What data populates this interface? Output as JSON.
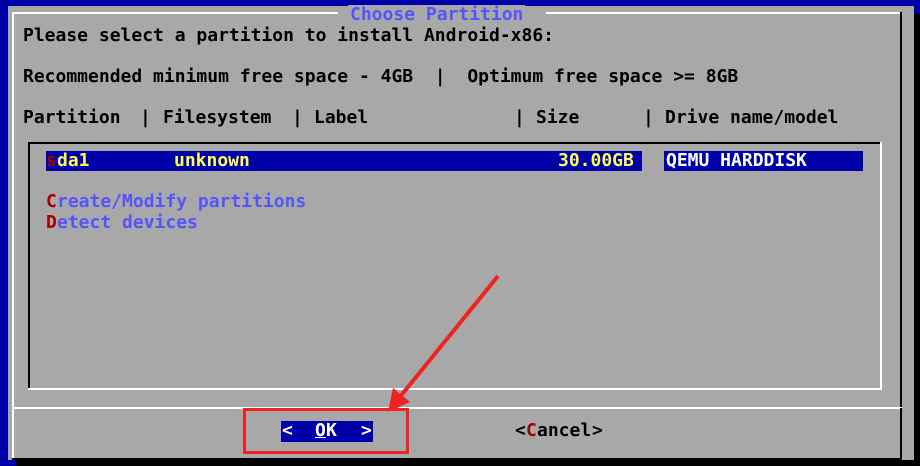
{
  "dialog": {
    "title": "Choose Partition",
    "prompt": "Please select a partition to install Android-x86:",
    "space_info": "Recommended minimum free space - 4GB  |  Optimum free space >= 8GB",
    "headers": {
      "partition": "Partition",
      "filesystem": "Filesystem",
      "label": "Label",
      "size": "Size",
      "drive": "Drive name/model",
      "separator": "|"
    }
  },
  "partitions": [
    {
      "hotkey": "s",
      "name_rest": "da1",
      "filesystem": "unknown",
      "size": "30.00GB",
      "model": "QEMU HARDDISK"
    }
  ],
  "actions": [
    {
      "hotkey": "C",
      "rest": "reate/Modify partitions"
    },
    {
      "hotkey": "D",
      "rest": "etect devices"
    }
  ],
  "buttons": {
    "ok": {
      "left": "<",
      "hotkey": "O",
      "rest": "K",
      "right": ">"
    },
    "cancel": {
      "left": "<",
      "hotkey": "C",
      "rest": "ancel",
      "right": ">"
    }
  },
  "colors": {
    "screen_bg": "#0000a8",
    "dialog_bg": "#a8a8a8",
    "hotkey": "#a80000",
    "menu_text": "#5454fc",
    "selected_text": "#fcfc54",
    "highlight_annotation": "#ee2222"
  }
}
